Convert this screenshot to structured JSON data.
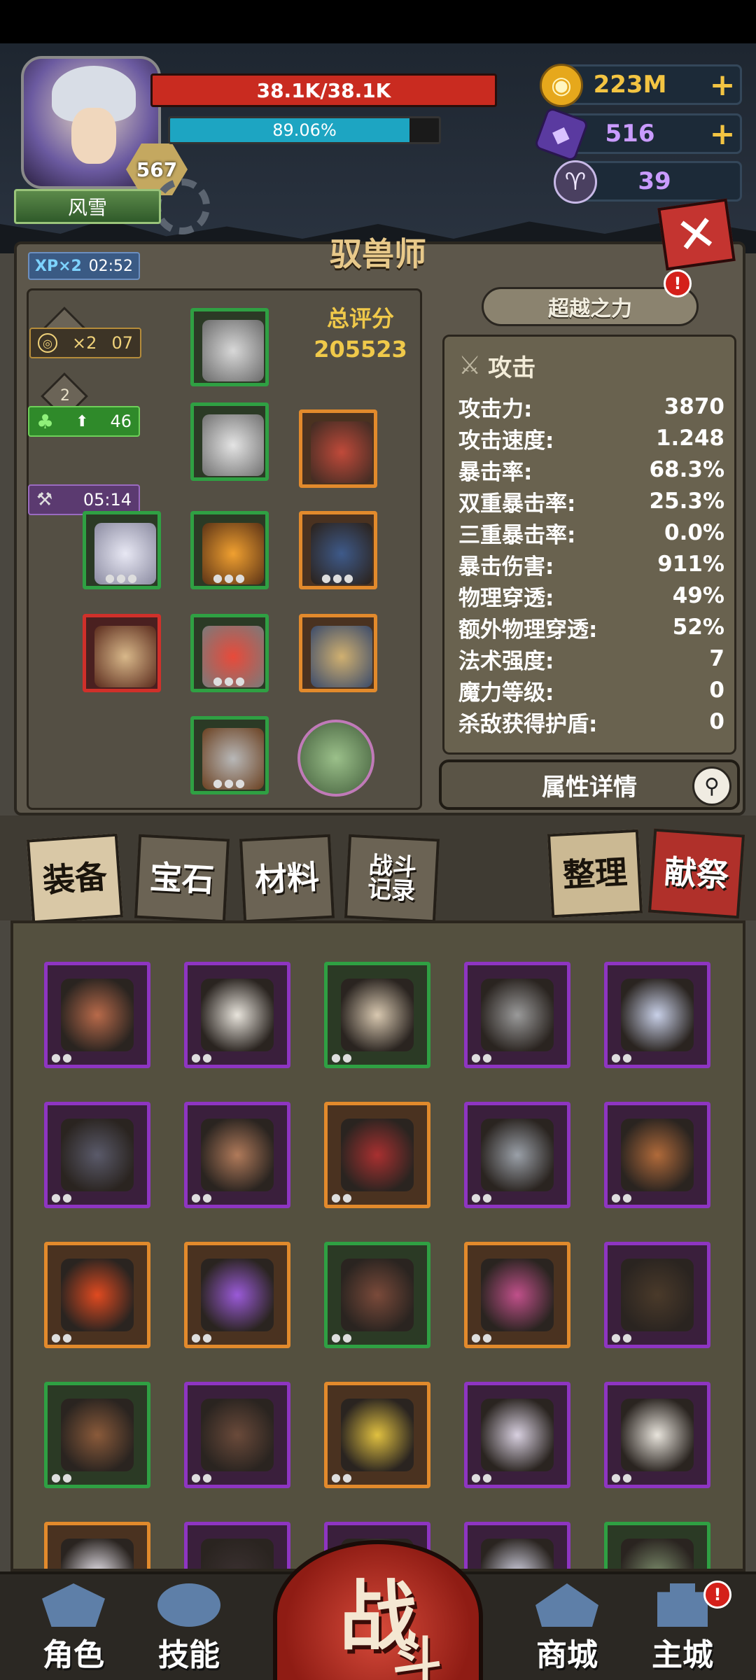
{
  "player": {
    "name": "风雪",
    "level": "567",
    "hp": "38.1K/38.1K",
    "xp_percent_text": "89.06%",
    "xp_fraction": 0.8906
  },
  "currencies": {
    "gold": "223M",
    "gems": "516",
    "ram": "39",
    "plus": "+"
  },
  "panel": {
    "class_title": "驭兽师",
    "xp_boost_label": "XP×2",
    "xp_boost_time": "02:52",
    "score_title": "总评分",
    "score_value": "205523",
    "buffs": {
      "gold_mult": "×2",
      "gold_time": "07",
      "diamond_count": "2",
      "luck_value": "46",
      "forge_time": "05:14"
    },
    "transcend_label": "超越之力",
    "alert": "!"
  },
  "stats": {
    "header": "攻击",
    "rows": [
      {
        "label": "攻击力:",
        "value": "3870"
      },
      {
        "label": "攻击速度:",
        "value": "1.248"
      },
      {
        "label": "暴击率:",
        "value": "68.3%"
      },
      {
        "label": "双重暴击率:",
        "value": "25.3%"
      },
      {
        "label": "三重暴击率:",
        "value": "0.0%"
      },
      {
        "label": "暴击伤害:",
        "value": "911%"
      },
      {
        "label": "物理穿透:",
        "value": "49%"
      },
      {
        "label": "额外物理穿透:",
        "value": "52%"
      },
      {
        "label": "法术强度:",
        "value": "7"
      },
      {
        "label": "魔力等级:",
        "value": "0"
      },
      {
        "label": "杀敌获得护盾:",
        "value": "0"
      }
    ],
    "detail_label": "属性详情"
  },
  "tabs": {
    "equipment": "装备",
    "gems": "宝石",
    "materials": "材料",
    "battle_log_1": "战斗",
    "battle_log_2": "记录",
    "sort": "整理",
    "sacrifice": "献祭"
  },
  "nav": {
    "character": "角色",
    "skills": "技能",
    "battle_1": "战",
    "battle_2": "斗",
    "shop": "商城",
    "city": "主城"
  },
  "colors": {
    "rarity_green": "#2fa043",
    "rarity_orange": "#e28a2c",
    "rarity_purple": "#8e35c2",
    "rarity_red": "#d0302a",
    "hp": "#c92b20",
    "xp": "#1da5c2",
    "score": "#f0c94a"
  }
}
